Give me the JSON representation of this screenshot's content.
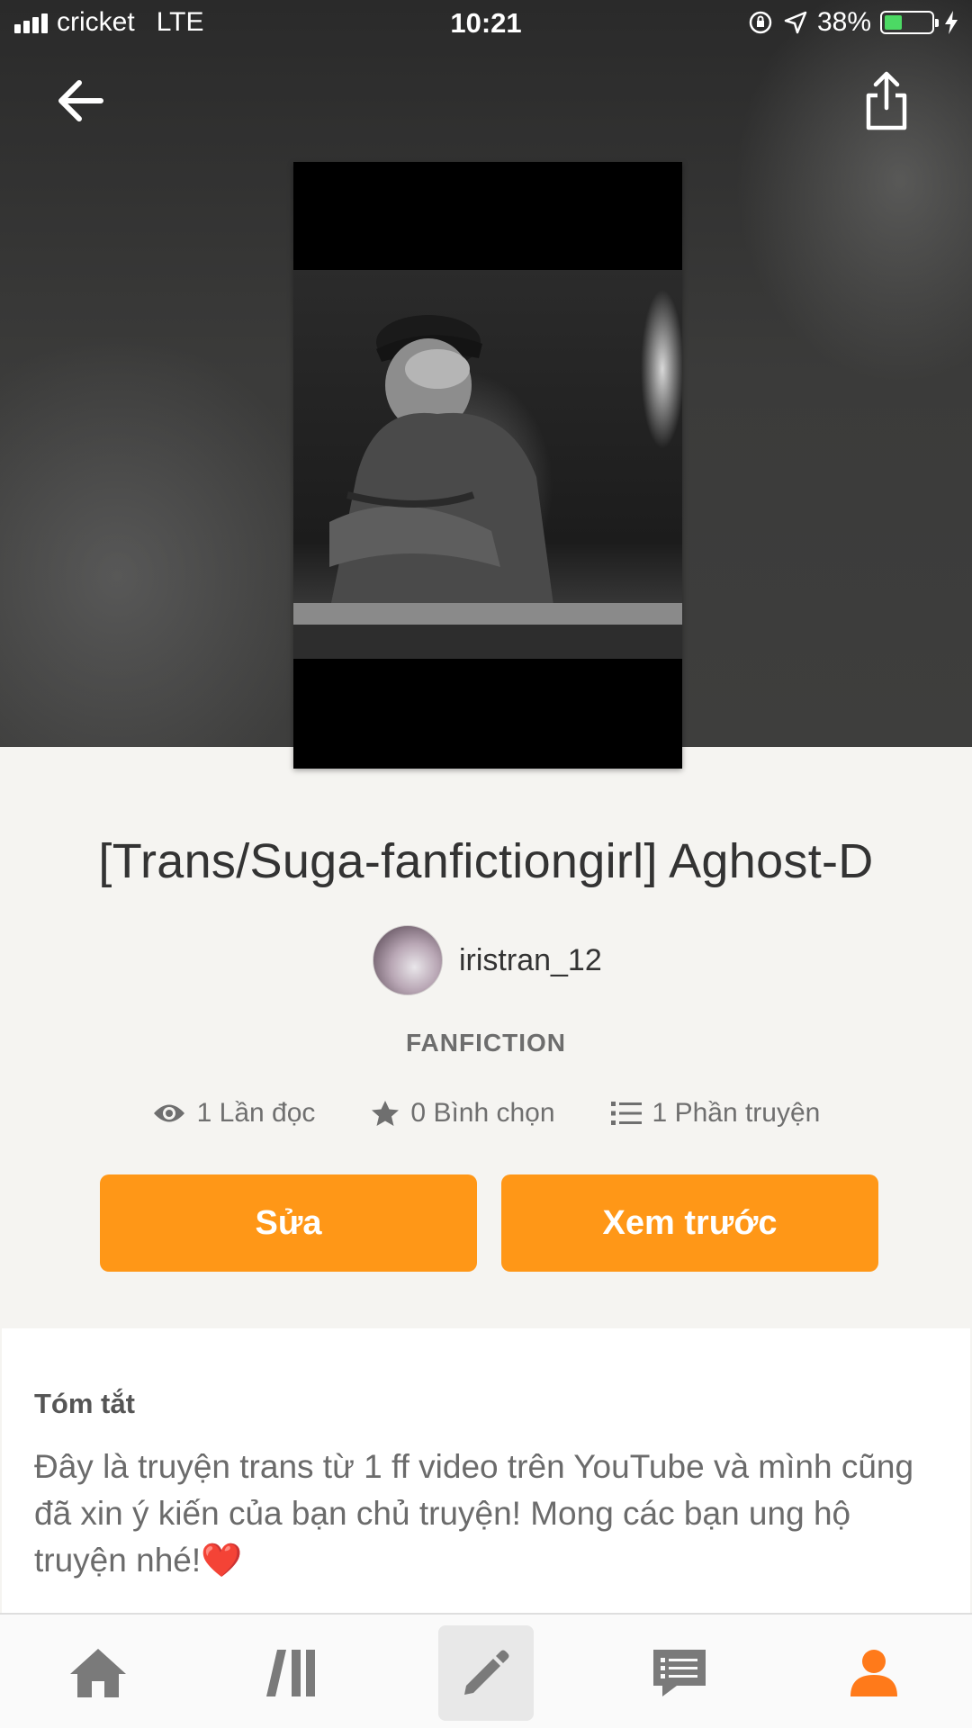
{
  "status_bar": {
    "carrier": "cricket",
    "network": "LTE",
    "time": "10:21",
    "battery_percent": "38%",
    "battery_level": 0.38,
    "icons": [
      "signal-icon",
      "orientation-lock-icon",
      "location-arrow-icon",
      "battery-icon",
      "charging-bolt-icon"
    ]
  },
  "header": {
    "back_icon": "arrow-left-icon",
    "share_icon": "share-icon"
  },
  "story": {
    "title": "[Trans/Suga-fanfictiongirl] Aghost-D",
    "author": "iristran_12",
    "category": "FANFICTION",
    "stats": {
      "reads": "1 Lần đọc",
      "votes": "0 Bình chọn",
      "parts": "1 Phần truyện"
    }
  },
  "actions": {
    "edit_label": "Sửa",
    "preview_label": "Xem trước"
  },
  "summary": {
    "heading": "Tóm tắt",
    "text": "Đây là truyện trans từ 1 ff video trên YouTube và mình cũng đã xin ý kiến của bạn chủ truyện! Mong các bạn ung hộ truyện nhé!",
    "emoji": "❤️"
  },
  "bottom_nav": {
    "items": [
      "home-icon",
      "library-icon",
      "write-icon",
      "messages-icon",
      "profile-icon"
    ],
    "active": "write-icon"
  },
  "colors": {
    "accent": "#ff9717",
    "profile_active": "#ff7a1a",
    "battery": "#4cd964"
  }
}
